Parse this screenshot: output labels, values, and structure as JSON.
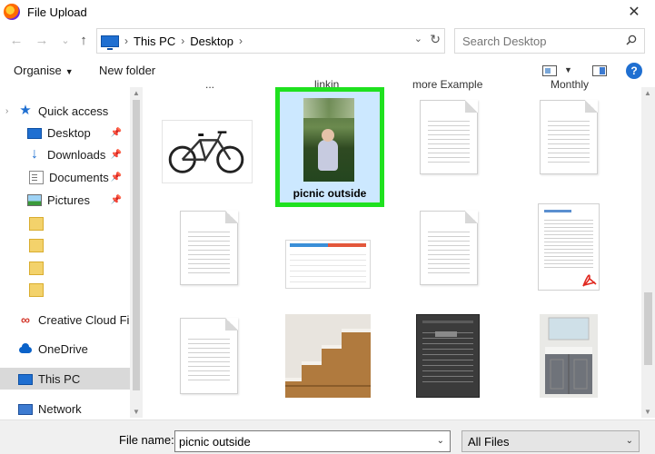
{
  "window": {
    "title": "File Upload",
    "close_glyph": "✕"
  },
  "nav": {
    "back_glyph": "←",
    "forward_glyph": "→",
    "recent_glyph": "⌄",
    "up_glyph": "↑",
    "breadcrumb": [
      "This PC",
      "Desktop"
    ],
    "sep_glyph": "›",
    "dropdown_glyph": "⌄",
    "refresh_glyph": "↻"
  },
  "search": {
    "placeholder": "Search Desktop"
  },
  "toolbar": {
    "organise_label": "Organise",
    "organise_caret": "▼",
    "new_folder_label": "New folder",
    "view_caret": "▼",
    "help_glyph": "?"
  },
  "sidebar": {
    "chevron": "›",
    "pin_glyph": "📌",
    "items": [
      {
        "label": "Quick access",
        "icon": "star-icon"
      },
      {
        "label": "Desktop",
        "icon": "desktop-icon",
        "pinned": true
      },
      {
        "label": "Downloads",
        "icon": "download-icon",
        "pinned": true
      },
      {
        "label": "Documents",
        "icon": "documents-icon",
        "pinned": true
      },
      {
        "label": "Pictures",
        "icon": "pictures-icon",
        "pinned": true
      },
      {
        "label": "",
        "icon": "folder-icon"
      },
      {
        "label": "",
        "icon": "folder-icon"
      },
      {
        "label": "",
        "icon": "folder-icon"
      },
      {
        "label": "",
        "icon": "folder-icon"
      },
      {
        "label": "Creative Cloud Fil",
        "icon": "creative-cloud-icon"
      },
      {
        "label": "OneDrive",
        "icon": "onedrive-icon"
      },
      {
        "label": "This PC",
        "icon": "this-pc-icon",
        "selected": true
      },
      {
        "label": "Network",
        "icon": "network-icon"
      }
    ]
  },
  "content": {
    "column_labels": [
      "...",
      "linkin",
      "more Example",
      "Monthly"
    ],
    "selected_file": {
      "label": "picnic outside"
    }
  },
  "bottom": {
    "file_name_label": "File name:",
    "file_name_value": "picnic outside",
    "file_type_value": "All Files",
    "dropdown_glyph": "⌄"
  },
  "colors": {
    "accent": "#1f6fd1",
    "selection_highlight": "#1fe11f",
    "selected_tile_bg": "#cce8ff"
  }
}
